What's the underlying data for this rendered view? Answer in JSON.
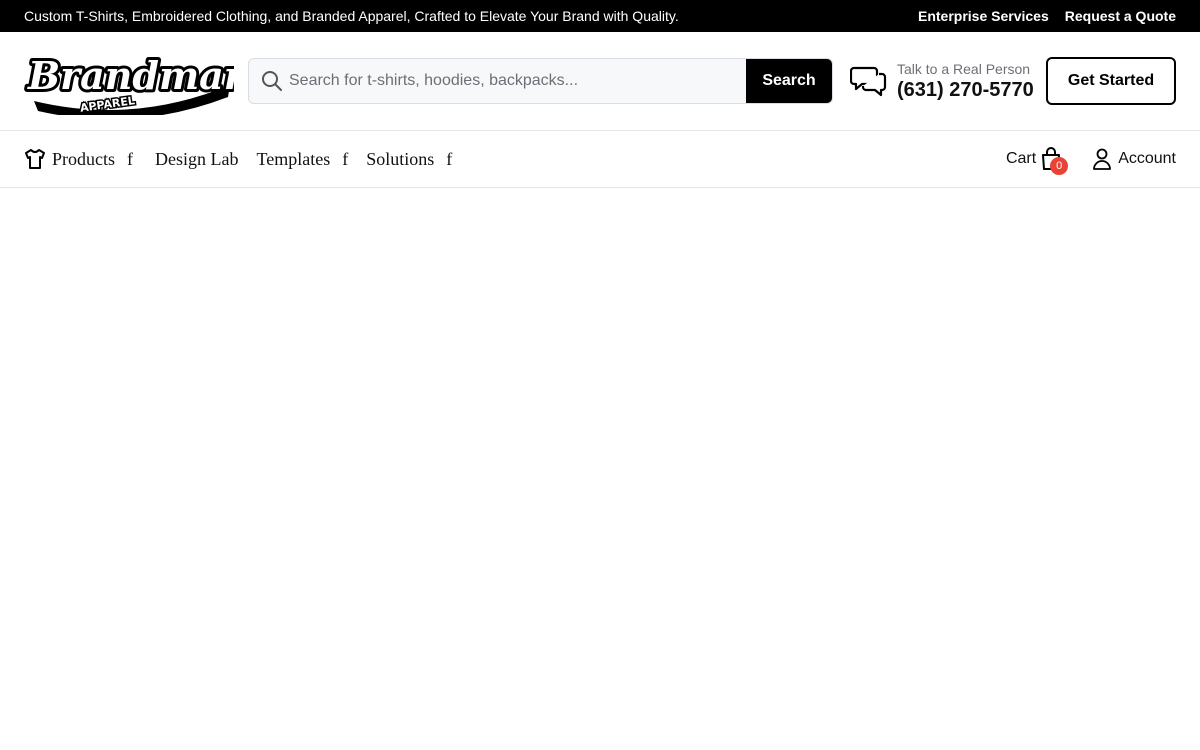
{
  "topbar": {
    "tagline": "Custom T-Shirts, Embroidered Clothing, and Branded Apparel, Crafted to Elevate Your Brand with Quality.",
    "links": [
      "Enterprise Services",
      "Request a Quote"
    ]
  },
  "header": {
    "logo": {
      "text": "Brandmark",
      "subtext": "APPAREL"
    },
    "search": {
      "placeholder": "Search for t-shirts, hoodies, backpacks...",
      "value": "",
      "button": "Search"
    },
    "contact": {
      "label": "Talk to a Real Person",
      "phone": "(631) 270-5770"
    },
    "cta": "Get Started"
  },
  "nav": {
    "items": [
      {
        "label": "Products",
        "caret": "f"
      },
      {
        "label": "Design Lab"
      },
      {
        "label": "Templates",
        "caret": "f"
      },
      {
        "label": "Solutions",
        "caret": "f"
      }
    ],
    "cart": {
      "label": "Cart",
      "count": "0"
    },
    "account": {
      "label": "Account"
    }
  },
  "colors": {
    "badge": "#ea4335",
    "topbar_bg": "#000000",
    "primary": "#000000"
  },
  "icons": [
    "search-icon",
    "chat-icon",
    "tshirt-icon",
    "shopping-bag-icon",
    "user-icon"
  ]
}
